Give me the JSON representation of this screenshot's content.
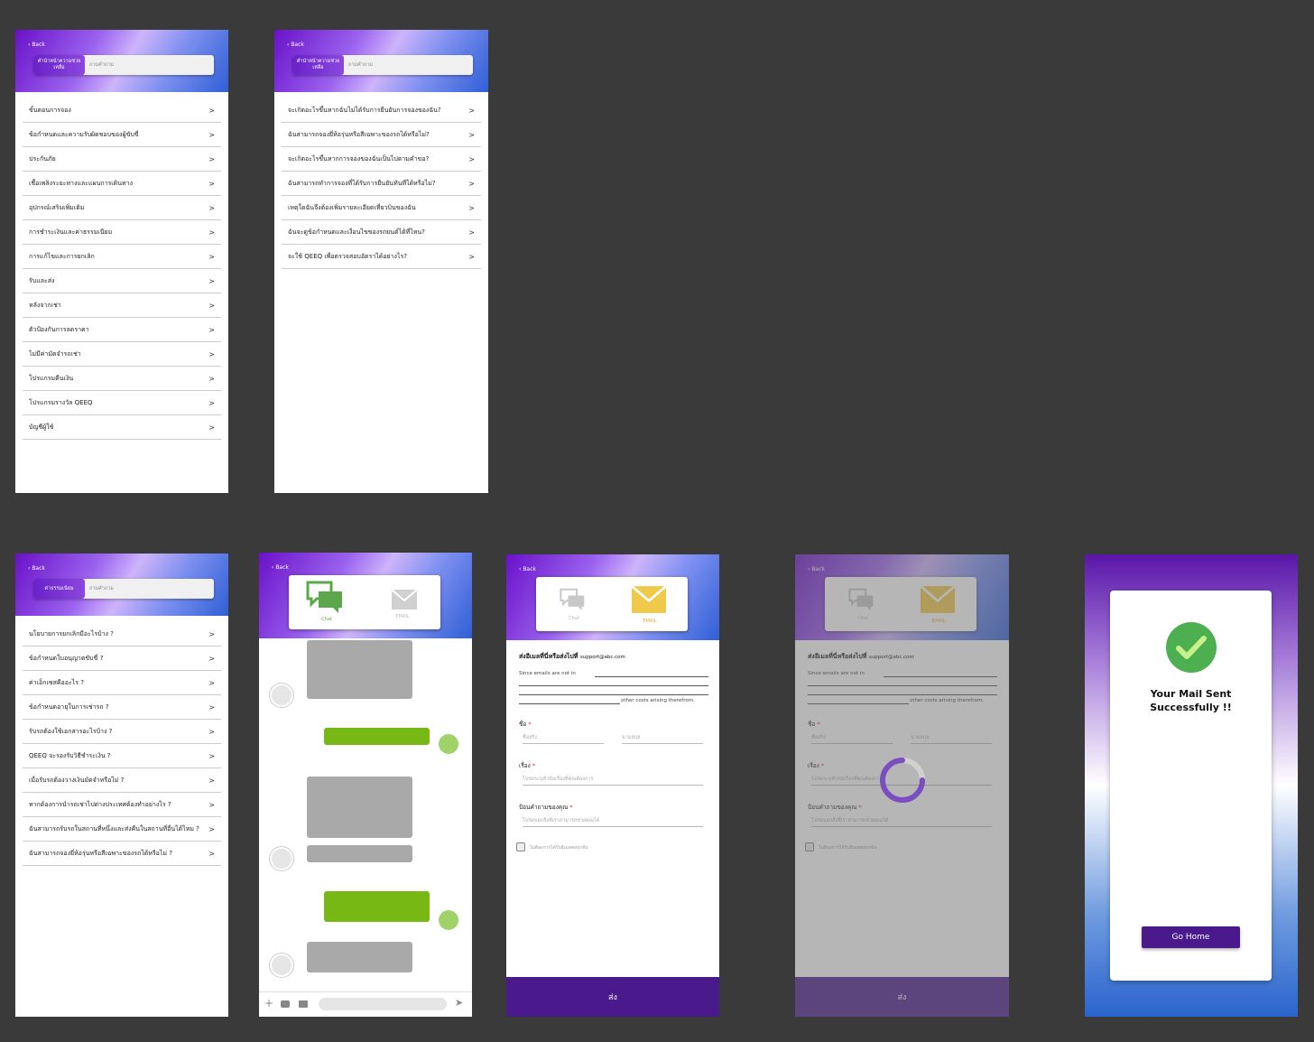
{
  "common": {
    "back_label": "Back",
    "search_placeholder": "ถามคำถาม",
    "send_label": "ส่ง",
    "chevron": ">"
  },
  "screen1": {
    "search_button": "คำนำหน้าความช่วยเหลือ",
    "items": [
      "ขั้นตอนการจอง",
      "ข้อกำหนดและความรับผิดชอบของผู้ขับขี่",
      "ประกันภัย",
      "เชื้อเพลิงระยะทางและแผนการเดินทาง",
      "อุปกรณ์เสริมเพิ่มเติม",
      "การชำระเงินและค่าธรรมเนียม",
      "การแก้ไขและการยกเลิก",
      "รับและส่ง",
      "หลังจากเช่า",
      "ตัวป้องกันการลดราคา",
      "ไม่มีค่ามัดจำรถเช่า",
      "โปรแกรมคืนเงิน",
      "โปรแกรมรางวัล QEEQ",
      "บัญชีผู้ใช้"
    ]
  },
  "screen2": {
    "search_button": "คำนำหน้าความช่วยเหลือ",
    "items": [
      "จะเกิดอะไรขึ้นหากฉันไม่ได้รับการยืนยันการจองของฉัน?",
      "ฉันสามารถจองยี่ห้อรุ่นหรือสีเฉพาะของรถได้หรือไม่?",
      "จะเกิดอะไรขึ้นหากการจองของฉันเป็นไปตามคำขอ?",
      "ฉันสามารถทำการจองที่ได้รับการยืนยันทันทีได้หรือไม่?",
      "เหตุใดฉันจึงต้องเพิ่มรายละเอียดเที่ยวบินของฉัน",
      "ฉันจะดูข้อกำหนดและเงื่อนไขของรถยนต์ได้ที่ไหน?",
      "จะใช้ QEEQ เพื่อตรวจสอบอัตราได้อย่างไร?"
    ]
  },
  "screen3": {
    "search_button": "ค่าธรรมเนียม",
    "items": [
      "นโยบายการยกเลิกมีอะไรบ้าง ?",
      "ข้อกำหนดใบอนุญาตขับขี่ ?",
      "ค่าเอ็กเซสคืออะไร ?",
      "ข้อกำหนดอายุในการเช่ารถ ?",
      "รับรถต้องใช้เอกสารอะไรบ้าง ?",
      "QEEQ จะรองรับวิธีชำระเงิน ?",
      "เมื่อรับรถต้องวางเงินมัดจำหรือไม่ ?",
      "หากต้องการนำรถเช่าไปต่างประเทศต้องทำอย่างไร ?",
      "ฉันสามารถรับรถในสถานที่หนึ่งและส่งคืนในสถานที่อื่นได้ไหม ?",
      "ฉันสามารถจองยี่ห้อรุ่นหรือสีเฉพาะของรถได้หรือไม่ ?"
    ]
  },
  "chat": {
    "tab_chat": "Chat",
    "tab_email": "EMAIL"
  },
  "email_form": {
    "title": "ส่งอีเมลที่นี่หรือส่งไปที่",
    "email": "support@abc.com",
    "note_line1": "Since emails are not in",
    "note_line4": "other costs arising therefrom.",
    "name_label": "ชื่อ",
    "first_name_placeholder": "ชื่อจริง",
    "last_name_placeholder": "นามสกุล",
    "subject_label": "เรื่อง",
    "subject_placeholder": "โปรดระบุหัวข้อเรื่องที่คุณต้องการ",
    "question_label": "ป้อนคำถามของคุณ",
    "question_placeholder": "โปรดบอกสิ่งที่เราสามารถช่วยคุณได้",
    "checkbox_label": "ไม่ต้องการได้รับอีเมลตอบกลับ",
    "required_mark": "*"
  },
  "success": {
    "title": "Your Mail Sent Successfully !!",
    "button": "Go Home"
  },
  "colors": {
    "purple": "#4a1a8c",
    "green_bubble": "#77b814",
    "mail_yellow": "#f0c94a",
    "chat_green": "#5aa84a",
    "success_green": "#4caf50"
  }
}
